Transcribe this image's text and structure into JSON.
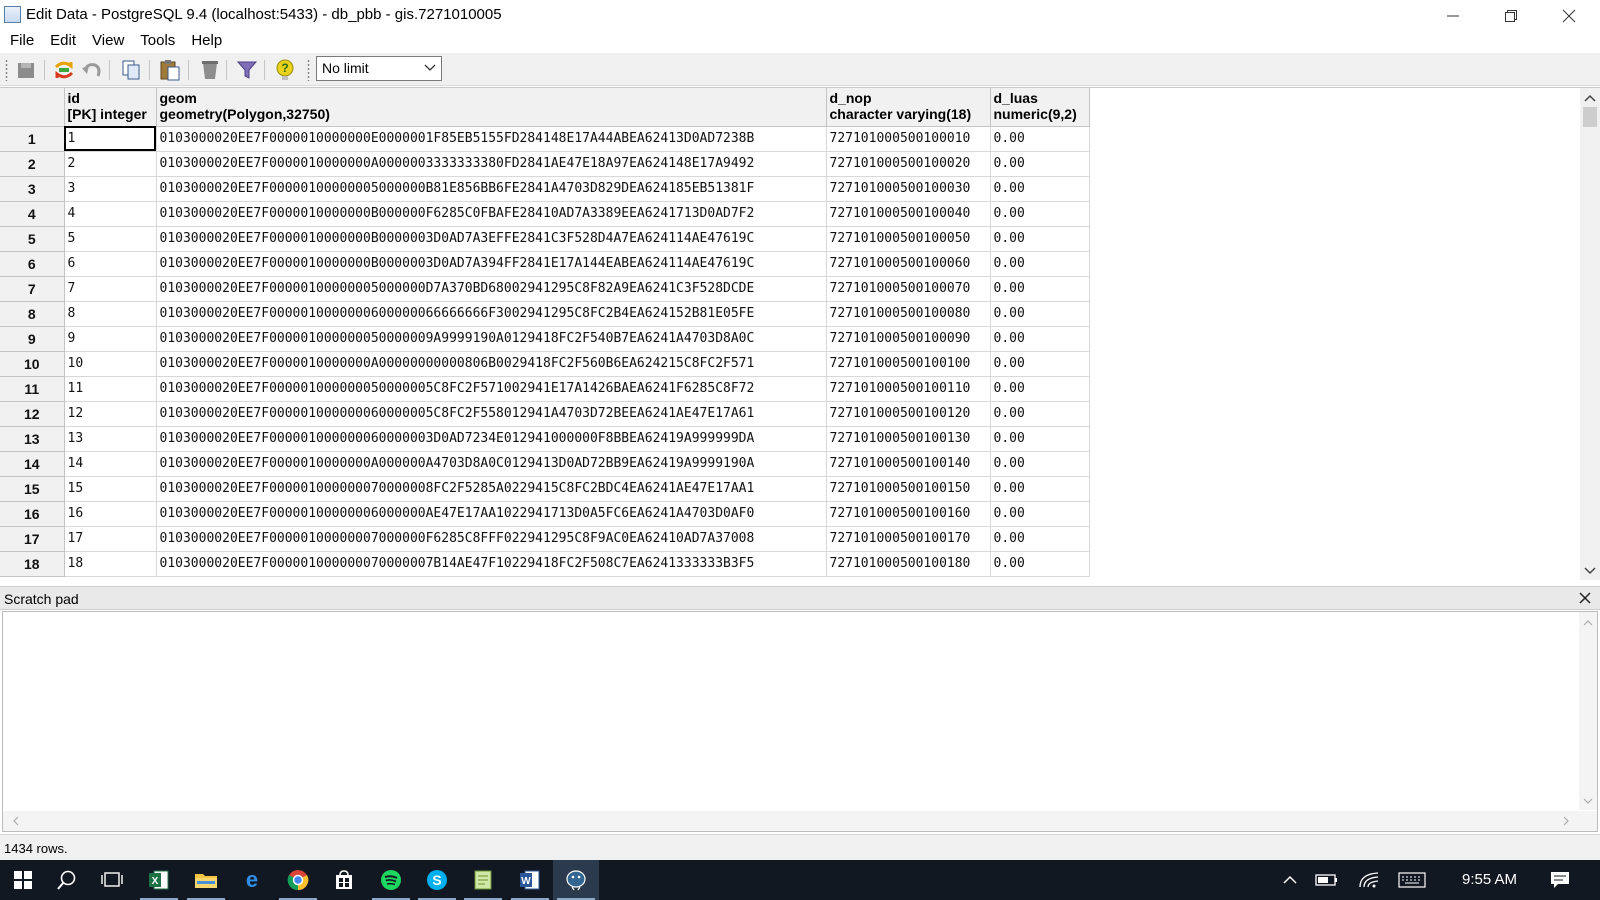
{
  "window": {
    "title": "Edit Data - PostgreSQL 9.4 (localhost:5433) - db_pbb - gis.7271010005"
  },
  "menu": [
    "File",
    "Edit",
    "View",
    "Tools",
    "Help"
  ],
  "toolbar": {
    "buttons": [
      "save-icon",
      "refresh-icon",
      "undo-icon",
      "copy-icon",
      "paste-icon",
      "delete-icon",
      "filter-icon",
      "help-icon"
    ],
    "limit_value": "No limit"
  },
  "grid": {
    "columns": [
      {
        "name": "id",
        "type": "[PK] integer"
      },
      {
        "name": "geom",
        "type": "geometry(Polygon,32750)"
      },
      {
        "name": "d_nop",
        "type": "character varying(18)"
      },
      {
        "name": "d_luas",
        "type": "numeric(9,2)"
      }
    ],
    "rows": [
      {
        "num": "1",
        "id": "1",
        "geom": "0103000020EE7F0000010000000E0000001F85EB5155FD284148E17A44ABEA62413D0AD7238B",
        "d_nop": "727101000500100010",
        "d_luas": "0.00"
      },
      {
        "num": "2",
        "id": "2",
        "geom": "0103000020EE7F0000010000000A0000003333333380FD2841AE47E18A97EA624148E17A9492",
        "d_nop": "727101000500100020",
        "d_luas": "0.00"
      },
      {
        "num": "3",
        "id": "3",
        "geom": "0103000020EE7F00000100000005000000B81E856BB6FE2841A4703D829DEA624185EB51381F",
        "d_nop": "727101000500100030",
        "d_luas": "0.00"
      },
      {
        "num": "4",
        "id": "4",
        "geom": "0103000020EE7F0000010000000B000000F6285C0FBAFE28410AD7A3389EEA6241713D0AD7F2",
        "d_nop": "727101000500100040",
        "d_luas": "0.00"
      },
      {
        "num": "5",
        "id": "5",
        "geom": "0103000020EE7F0000010000000B0000003D0AD7A3EFFE2841C3F528D4A7EA624114AE47619C",
        "d_nop": "727101000500100050",
        "d_luas": "0.00"
      },
      {
        "num": "6",
        "id": "6",
        "geom": "0103000020EE7F0000010000000B0000003D0AD7A394FF2841E17A144EABEA624114AE47619C",
        "d_nop": "727101000500100060",
        "d_luas": "0.00"
      },
      {
        "num": "7",
        "id": "7",
        "geom": "0103000020EE7F00000100000005000000D7A370BD68002941295C8F82A9EA6241C3F528DCDE",
        "d_nop": "727101000500100070",
        "d_luas": "0.00"
      },
      {
        "num": "8",
        "id": "8",
        "geom": "0103000020EE7F0000010000000600000066666666F3002941295C8FC2B4EA624152B81E05FE",
        "d_nop": "727101000500100080",
        "d_luas": "0.00"
      },
      {
        "num": "9",
        "id": "9",
        "geom": "0103000020EE7F000001000000050000009A9999190A0129418FC2F540B7EA6241A4703D8A0C",
        "d_nop": "727101000500100090",
        "d_luas": "0.00"
      },
      {
        "num": "10",
        "id": "10",
        "geom": "0103000020EE7F0000010000000A00000000000806B0029418FC2F560B6EA624215C8FC2F571",
        "d_nop": "727101000500100100",
        "d_luas": "0.00"
      },
      {
        "num": "11",
        "id": "11",
        "geom": "0103000020EE7F000001000000050000005C8FC2F571002941E17A1426BAEA6241F6285C8F72",
        "d_nop": "727101000500100110",
        "d_luas": "0.00"
      },
      {
        "num": "12",
        "id": "12",
        "geom": "0103000020EE7F000001000000060000005C8FC2F558012941A4703D72BEEA6241AE47E17A61",
        "d_nop": "727101000500100120",
        "d_luas": "0.00"
      },
      {
        "num": "13",
        "id": "13",
        "geom": "0103000020EE7F000001000000060000003D0AD7234E012941000000F8BBEA62419A999999DA",
        "d_nop": "727101000500100130",
        "d_luas": "0.00"
      },
      {
        "num": "14",
        "id": "14",
        "geom": "0103000020EE7F0000010000000A000000A4703D8A0C0129413D0AD72BB9EA62419A9999190A",
        "d_nop": "727101000500100140",
        "d_luas": "0.00"
      },
      {
        "num": "15",
        "id": "15",
        "geom": "0103000020EE7F000001000000070000008FC2F5285A0229415C8FC2BDC4EA6241AE47E17AA1",
        "d_nop": "727101000500100150",
        "d_luas": "0.00"
      },
      {
        "num": "16",
        "id": "16",
        "geom": "0103000020EE7F00000100000006000000AE47E17AA1022941713D0A5FC6EA6241A4703D0AF0",
        "d_nop": "727101000500100160",
        "d_luas": "0.00"
      },
      {
        "num": "17",
        "id": "17",
        "geom": "0103000020EE7F00000100000007000000F6285C8FFF022941295C8F9AC0EA62410AD7A37008",
        "d_nop": "727101000500100170",
        "d_luas": "0.00"
      },
      {
        "num": "18",
        "id": "18",
        "geom": "0103000020EE7F000001000000070000007B14AE47F10229418FC2F508C7EA6241333333B3F5",
        "d_nop": "727101000500100180",
        "d_luas": "0.00"
      }
    ]
  },
  "scratch_pad": {
    "title": "Scratch pad"
  },
  "status": {
    "text": "1434 rows."
  },
  "taskbar": {
    "icons": [
      "windows-start-icon",
      "search-icon",
      "task-view-icon",
      "excel-icon",
      "file-explorer-icon",
      "edge-icon",
      "chrome-icon",
      "store-icon",
      "spotify-icon",
      "skype-icon",
      "notepad-icon",
      "word-icon",
      "pgadmin-icon"
    ],
    "clock": "9:55 AM"
  }
}
